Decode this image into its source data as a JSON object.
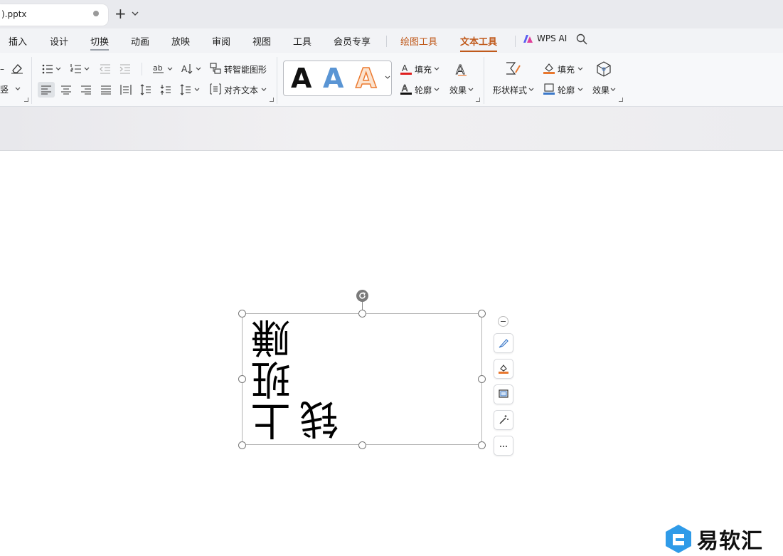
{
  "tabs": {
    "doc_name": ").pptx",
    "new_tab_glyph": "+"
  },
  "menu": {
    "items": [
      "插入",
      "设计",
      "切换",
      "动画",
      "放映",
      "审阅",
      "视图",
      "工具",
      "会员专享",
      "绘图工具",
      "文本工具"
    ],
    "wps_ai": "WPS AI",
    "active": "文本工具"
  },
  "ribbon": {
    "partial_left_label": "竖",
    "smart_shape": "转智能图形",
    "align_text": "对齐文本",
    "text_fill": "填充",
    "text_outline": "轮廓",
    "text_effect": "效果",
    "shape_style": "形状样式",
    "shape_fill": "填充",
    "shape_outline": "轮廓",
    "shape_effect": "效果",
    "style_sample": "A",
    "colors": {
      "fill_red": "#e02020",
      "outline_black": "#111111",
      "shape_fill_orange": "#e8772e",
      "shape_outline_blue": "#3a78c9",
      "accent_orange": "#c05a1c"
    }
  },
  "textbox": {
    "line1": "上班赚",
    "line2": "钱"
  },
  "watermark": {
    "text": "易软汇"
  }
}
